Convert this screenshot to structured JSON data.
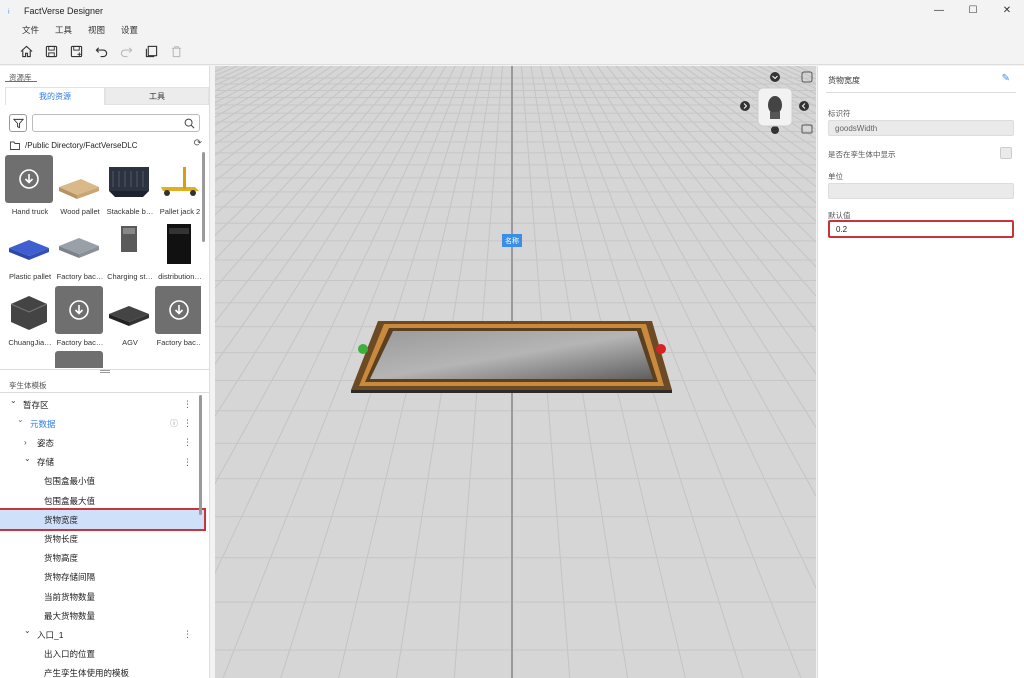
{
  "window": {
    "title": "FactVerse Designer"
  },
  "menu": [
    "文件",
    "工具",
    "视图",
    "设置"
  ],
  "library": {
    "title": "资源库",
    "tabs": [
      "我的资源",
      "工具"
    ],
    "path": "/Public Directory/FactVerseDLC",
    "assets": [
      {
        "label": "Hand truck",
        "download": true
      },
      {
        "label": "Wood pallet",
        "download": false
      },
      {
        "label": "Stackable b…",
        "download": false
      },
      {
        "label": "Pallet jack 2",
        "download": false
      },
      {
        "label": "Plastic pallet",
        "download": false
      },
      {
        "label": "Factory bac…",
        "download": false
      },
      {
        "label": "Charging st…",
        "download": false
      },
      {
        "label": "distribution…",
        "download": false
      },
      {
        "label": "ChuangJia…",
        "download": false
      },
      {
        "label": "Factory bac…",
        "download": true
      },
      {
        "label": "AGV",
        "download": false
      },
      {
        "label": "Factory bac…",
        "download": true
      }
    ]
  },
  "twin_templates": {
    "title": "孪生体模板",
    "rows": [
      {
        "label": "暂存区",
        "level": 0,
        "expanded": true,
        "more": true
      },
      {
        "label": "元数据",
        "level": 1,
        "expanded": true,
        "more": true,
        "info": true,
        "blue": true
      },
      {
        "label": "姿态",
        "level": 2,
        "expanded": false,
        "more": true
      },
      {
        "label": "存储",
        "level": 2,
        "expanded": true,
        "more": true
      },
      {
        "label": "包围盒最小值",
        "level": 3
      },
      {
        "label": "包围盒最大值",
        "level": 3
      },
      {
        "label": "货物宽度",
        "level": 3,
        "selected": true
      },
      {
        "label": "货物长度",
        "level": 3
      },
      {
        "label": "货物高度",
        "level": 3
      },
      {
        "label": "货物存储间隔",
        "level": 3
      },
      {
        "label": "当前货物数量",
        "level": 3
      },
      {
        "label": "最大货物数量",
        "level": 3
      },
      {
        "label": "入口_1",
        "level": 2,
        "expanded": true,
        "more": true
      },
      {
        "label": "出入口的位置",
        "level": 3
      },
      {
        "label": "产生孪生体使用的模板",
        "level": 3
      }
    ]
  },
  "viewport": {
    "name_tag": "名称"
  },
  "properties": {
    "title": "货物宽度",
    "identifier_label": "标识符",
    "identifier_value": "goodsWidth",
    "show_in_twin_label": "是否在孪生体中显示",
    "unit_label": "单位",
    "unit_value": "",
    "default_label": "默认值",
    "default_value": "0.2"
  },
  "colors": {
    "accent": "#2a7be4",
    "highlight": "#c9343a",
    "selection": "#cfe0fb"
  }
}
